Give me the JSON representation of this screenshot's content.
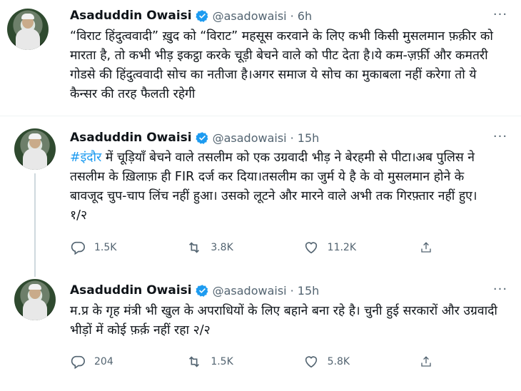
{
  "tweets": [
    {
      "name": "Asaduddin Owaisi",
      "handle": "@asadowaisi",
      "time": "· 6h",
      "text": "“विराट हिंदुत्ववादी” ख़ुद को “विराट” महसूस करवाने के लिए कभी किसी मुसलमान फ़क़ीर को मारता है, तो कभी भीड़ इकट्ठा करके चूड़ी बेचने वाले को पीट देता है।ये कम-ज़र्फ़ी और कमतरी गोडसे की हिंदुत्ववादी सोच का नतीजा है।अगर समाज ये सोच का मुकाबला नहीं करेगा तो ये कैन्सर की तरह फैलती रहेगी"
    },
    {
      "name": "Asaduddin Owaisi",
      "handle": "@asadowaisi",
      "time": "· 15h",
      "hashtag": "#इंदौर",
      "text": " में चूड़ियाँ बेचने वाले तसलीम को एक उग्रवादी भीड़ ने बेरहमी से पीटा।अब पुलिस ने तसलीम के ख़िलाफ़ ही FIR दर्ज कर दिया।तसलीम का जुर्म ये है के वो मुसलमान होने के बावजूद चुप-चाप लिंच नहीं हुआ। उसको लूटने और मारने वाले अभी तक गिरफ़्तार नहीं हुए। १/२",
      "replies": "1.5K",
      "retweets": "3.8K",
      "likes": "11.2K"
    },
    {
      "name": "Asaduddin Owaisi",
      "handle": "@asadowaisi",
      "time": "· 15h",
      "text": "म.प्र के गृह मंत्री भी खुल के अपराधियों के लिए बहाने बना रहे है। चुनी हुई सरकारों और उग्रवादी भीड़ों में कोई फ़र्क़ नहीं रहा २/२",
      "replies": "204",
      "retweets": "1.5K",
      "likes": "5.8K"
    }
  ],
  "icons": {
    "verified": "verified-badge-icon",
    "more": "more-options-icon",
    "reply": "reply-icon",
    "retweet": "retweet-icon",
    "like": "like-icon",
    "share": "share-icon"
  },
  "colors": {
    "accent": "#1d9bf0",
    "secondary_text": "#536471"
  }
}
